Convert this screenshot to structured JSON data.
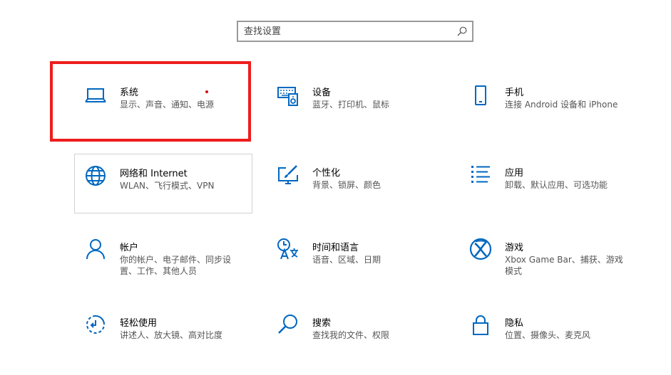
{
  "search": {
    "placeholder": "查找设置",
    "icon": "search-icon"
  },
  "accent_color": "#0067c0",
  "highlight_color": "#ee1c1c",
  "tiles": [
    {
      "id": "system",
      "title": "系统",
      "desc": "显示、声音、通知、电源",
      "icon": "laptop-icon"
    },
    {
      "id": "devices",
      "title": "设备",
      "desc": "蓝牙、打印机、鼠标",
      "icon": "keyboard-speaker-icon"
    },
    {
      "id": "phone",
      "title": "手机",
      "desc": "连接 Android 设备和 iPhone",
      "icon": "phone-icon"
    },
    {
      "id": "network",
      "title": "网络和 Internet",
      "desc": "WLAN、飞行模式、VPN",
      "icon": "globe-icon"
    },
    {
      "id": "personalization",
      "title": "个性化",
      "desc": "背景、锁屏、颜色",
      "icon": "paint-monitor-icon"
    },
    {
      "id": "apps",
      "title": "应用",
      "desc": "卸载、默认应用、可选功能",
      "icon": "apps-list-icon"
    },
    {
      "id": "accounts",
      "title": "帐户",
      "desc": "你的帐户、电子邮件、同步设置、工作、其他人员",
      "icon": "person-icon"
    },
    {
      "id": "time-language",
      "title": "时间和语言",
      "desc": "语音、区域、日期",
      "icon": "clock-language-icon"
    },
    {
      "id": "gaming",
      "title": "游戏",
      "desc": "Xbox Game Bar、捕获、游戏模式",
      "icon": "xbox-icon"
    },
    {
      "id": "ease-of-access",
      "title": "轻松使用",
      "desc": "讲述人、放大镜、高对比度",
      "icon": "ease-of-access-icon"
    },
    {
      "id": "search",
      "title": "搜索",
      "desc": "查找我的文件、权限",
      "icon": "magnifier-icon"
    },
    {
      "id": "privacy",
      "title": "隐私",
      "desc": "位置、摄像头、麦克风",
      "icon": "lock-icon"
    }
  ]
}
